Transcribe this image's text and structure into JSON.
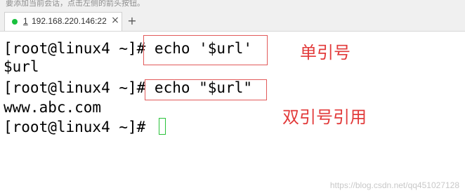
{
  "header": {
    "notice_text": "要添加当前会话，点击左侧的箭头按钮。",
    "tab": {
      "number": "1",
      "label": "192.168.220.146:22",
      "close_glyph": "×",
      "status_color": "#19c03e"
    },
    "new_tab_glyph": "+"
  },
  "terminal": {
    "lines": [
      "[root@linux4 ~]# echo '$url'",
      "$url",
      "[root@linux4 ~]# echo \"$url\"",
      "www.abc.com",
      "[root@linux4 ~]#"
    ]
  },
  "annotations": {
    "single_quote": "单引号",
    "double_quote": "双引号引用",
    "color": "#e23a3a"
  },
  "watermark": "https://blog.csdn.net/qq451027128"
}
